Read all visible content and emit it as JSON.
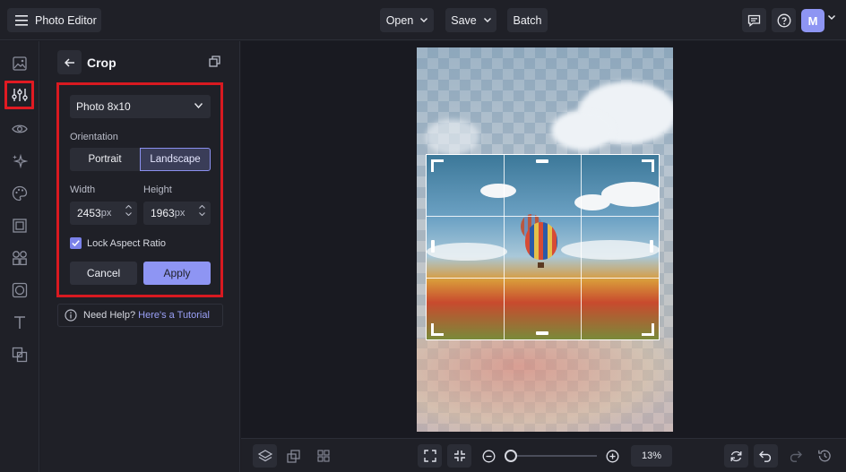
{
  "app": {
    "title": "Photo Editor",
    "user_initial": "M"
  },
  "header": {
    "open_label": "Open",
    "save_label": "Save",
    "batch_label": "Batch"
  },
  "sidebar_tools": [
    "image-icon",
    "adjustments-icon",
    "eye-icon",
    "sparkles-icon",
    "palette-icon",
    "frame-icon",
    "shapes-icon",
    "texture-icon",
    "text-icon",
    "overlay-icon"
  ],
  "panel": {
    "title": "Crop",
    "preset": "Photo 8x10",
    "orientation_label": "Orientation",
    "orientation_options": [
      "Portrait",
      "Landscape"
    ],
    "orientation_selected": "Landscape",
    "width_label": "Width",
    "height_label": "Height",
    "width_value": "2453",
    "height_value": "1963",
    "unit": "px",
    "lock_label": "Lock Aspect Ratio",
    "lock_checked": true,
    "cancel_label": "Cancel",
    "apply_label": "Apply",
    "help_text": "Need Help?",
    "help_link": "Here's a Tutorial"
  },
  "zoom": {
    "value": "13%"
  },
  "colors": {
    "accent": "#8e95f3",
    "highlight": "#d81920",
    "background": "#1c1d24"
  }
}
